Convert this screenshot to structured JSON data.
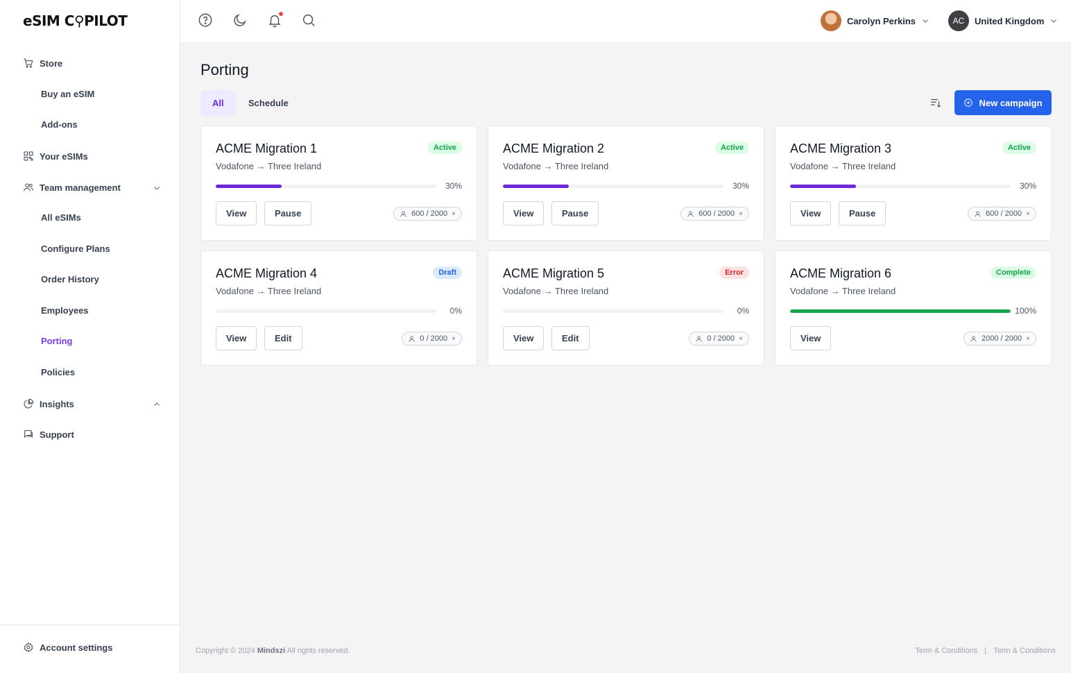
{
  "brand": {
    "logo": "eSIM C⚲PILOT"
  },
  "sidebar": {
    "store": "Store",
    "buy_esim": "Buy an eSIM",
    "add_ons": "Add-ons",
    "your_esims": "Your eSIMs",
    "team_management": "Team management",
    "all_esims": "All eSIMs",
    "configure_plans": "Configure Plans",
    "order_history": "Order History",
    "employees": "Employees",
    "porting": "Porting",
    "policies": "Policies",
    "insights": "Insights",
    "support": "Support",
    "account_settings": "Account settings"
  },
  "topbar": {
    "user_name": "Carolyn Perkins",
    "region_initials": "AC",
    "region": "United Kingdom"
  },
  "page": {
    "title": "Porting",
    "tabs": [
      "All",
      "Schedule"
    ],
    "new_campaign": "New campaign"
  },
  "colors": {
    "accent": "#6d28d9",
    "primary": "#2563eb",
    "progress": "#6d28d9",
    "complete": "#16a34a"
  },
  "cards": [
    {
      "title": "ACME Migration 1",
      "route": "Vodafone → Three Ireland",
      "status": "Active",
      "progress": 0.3,
      "pct_label": "30%",
      "actions": [
        "View",
        "Pause"
      ],
      "chip": "600 / 2000"
    },
    {
      "title": "ACME Migration 2",
      "route": "Vodafone → Three Ireland",
      "status": "Active",
      "progress": 0.3,
      "pct_label": "30%",
      "actions": [
        "View",
        "Pause"
      ],
      "chip": "600 / 2000"
    },
    {
      "title": "ACME Migration 3",
      "route": "Vodafone → Three Ireland",
      "status": "Active",
      "progress": 0.3,
      "pct_label": "30%",
      "actions": [
        "View",
        "Pause"
      ],
      "chip": "600 / 2000"
    },
    {
      "title": "ACME Migration 4",
      "route": "Vodafone → Three Ireland",
      "status": "Draft",
      "progress": 0,
      "pct_label": "0%",
      "actions": [
        "View",
        "Edit"
      ],
      "chip": "0 / 2000"
    },
    {
      "title": "ACME Migration 5",
      "route": "Vodafone → Three Ireland",
      "status": "Error",
      "progress": 0,
      "pct_label": "0%",
      "actions": [
        "View",
        "Edit"
      ],
      "chip": "0 / 2000"
    },
    {
      "title": "ACME Migration 6",
      "route": "Vodafone → Three Ireland",
      "status": "Complete",
      "progress": 1.0,
      "pct_label": "100%",
      "actions": [
        "View"
      ],
      "chip": "2000 / 2000"
    }
  ],
  "footer": {
    "copyright_prefix": "Copyright © 2024",
    "company": "Mindszi",
    "copyright_suffix": "All rights reserved.",
    "link1": "Term & Conditions",
    "separator": "|",
    "link2": "Term & Conditions"
  }
}
